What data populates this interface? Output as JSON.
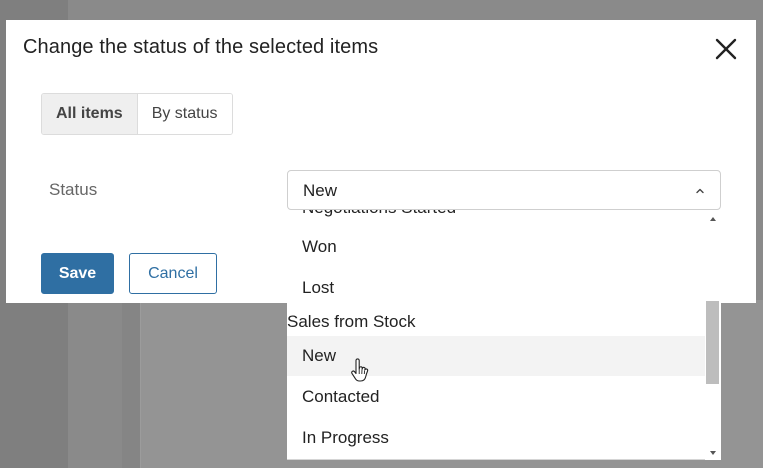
{
  "modal": {
    "title": "Change the status of the selected items",
    "tabs": [
      {
        "label": "All items",
        "active": true
      },
      {
        "label": "By status",
        "active": false
      }
    ],
    "status_label": "Status",
    "status_value": "New",
    "save_label": "Save",
    "cancel_label": "Cancel"
  },
  "dropdown": {
    "cut_off_item": "Negotiations Started",
    "items_before_group": [
      "Won",
      "Lost"
    ],
    "group_label": "Sales from Stock",
    "group_items": [
      "New",
      "Contacted",
      "In Progress"
    ],
    "hovered_item": "New"
  },
  "colors": {
    "primary": "#2f6fa3",
    "overlay": "#8a8a8a"
  },
  "icons": [
    "close-icon",
    "chevron-up-icon",
    "scroll-up-arrow-icon",
    "scroll-down-arrow-icon",
    "hand-pointer-cursor-icon"
  ]
}
